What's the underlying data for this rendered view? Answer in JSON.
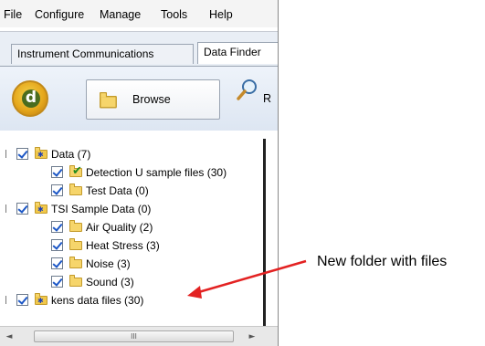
{
  "menu": [
    "File",
    "Configure",
    "Manage",
    "Tools",
    "Help"
  ],
  "tabs": [
    "Instrument Communications",
    "Data Finder"
  ],
  "toolbar": {
    "logo_letter": "d",
    "browse_label": "Browse",
    "truncated_label": "R"
  },
  "tree": [
    {
      "label": "Data (7)",
      "level": 0,
      "icon": "special-folder-icon"
    },
    {
      "label": "Detection U sample files (30)",
      "level": 1,
      "icon": "folder-check-icon"
    },
    {
      "label": "Test Data (0)",
      "level": 1,
      "icon": "folder-icon"
    },
    {
      "label": "TSI Sample Data (0)",
      "level": 0,
      "icon": "special-folder-icon"
    },
    {
      "label": "Air Quality (2)",
      "level": 1,
      "icon": "folder-icon"
    },
    {
      "label": "Heat Stress (3)",
      "level": 1,
      "icon": "folder-icon"
    },
    {
      "label": "Noise (3)",
      "level": 1,
      "icon": "folder-icon"
    },
    {
      "label": "Sound (3)",
      "level": 1,
      "icon": "folder-icon"
    },
    {
      "label": "kens data files (30)",
      "level": 0,
      "icon": "special-folder-icon"
    }
  ],
  "scrollbar": {
    "left_arrow": "◄",
    "right_arrow": "►",
    "grip": "III"
  },
  "annotation": {
    "text": "New folder with files",
    "arrow_color": "#e32222"
  }
}
